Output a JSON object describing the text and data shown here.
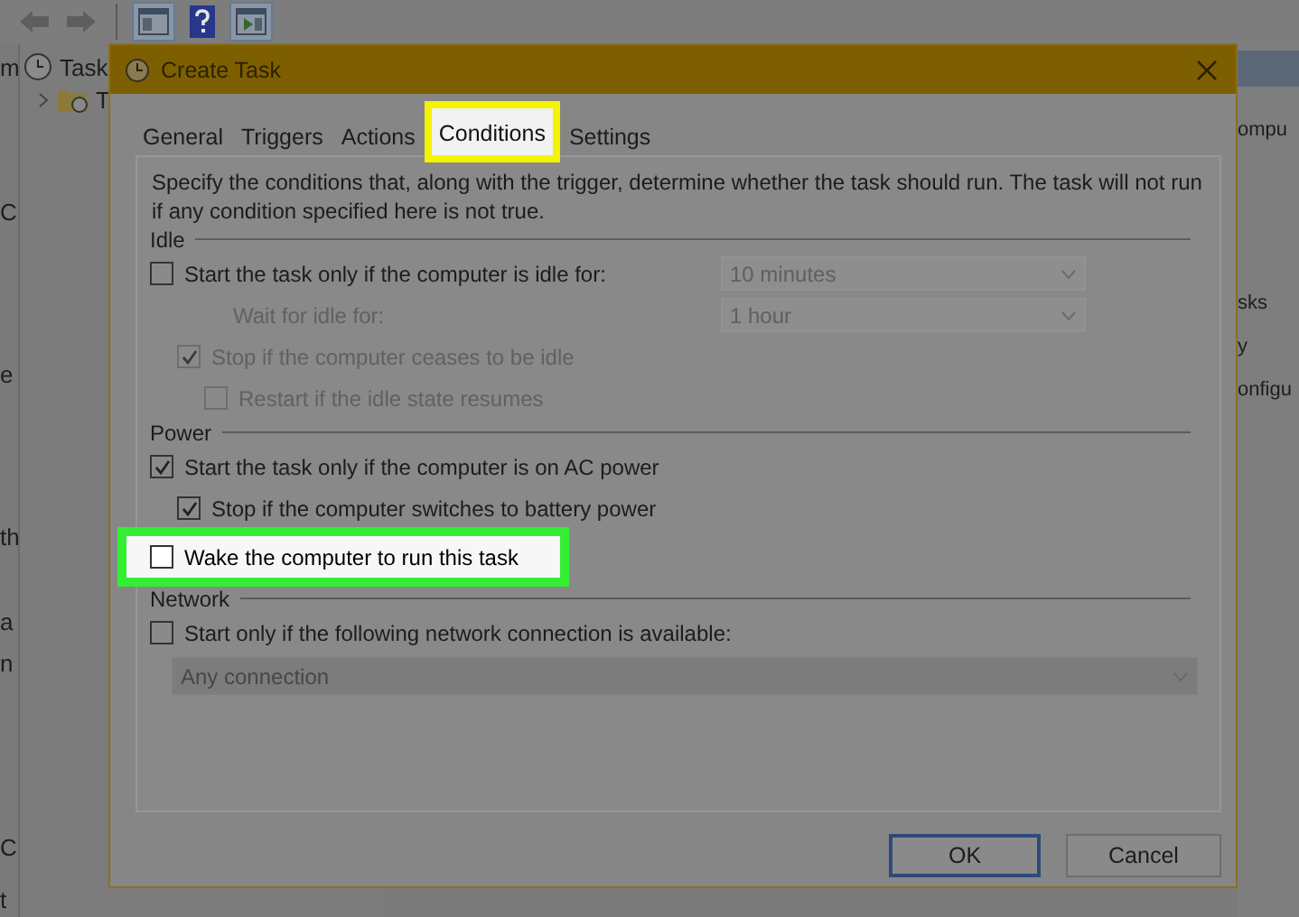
{
  "app": {
    "toolbar": [
      {
        "kind": "back"
      },
      {
        "kind": "forward"
      },
      {
        "kind": "panel"
      },
      {
        "kind": "help"
      },
      {
        "kind": "play-panel"
      }
    ],
    "tree": [
      {
        "label": "Task",
        "children": [
          {
            "label": "T"
          }
        ]
      }
    ],
    "left_fragments": [
      "m",
      "C",
      "e",
      "th",
      "a",
      "n",
      "C",
      "t"
    ],
    "right_fragments": [
      "ompu",
      "sks",
      "y",
      "onfigu"
    ]
  },
  "dialog": {
    "title": "Create Task",
    "tabs": [
      {
        "label": "General",
        "selected": false,
        "highlighted": false
      },
      {
        "label": "Triggers",
        "selected": false,
        "highlighted": false
      },
      {
        "label": "Actions",
        "selected": false,
        "highlighted": false
      },
      {
        "label": "Conditions",
        "selected": true,
        "highlighted": true
      },
      {
        "label": "Settings",
        "selected": false,
        "highlighted": false
      }
    ],
    "description": "Specify the conditions that, along with the trigger, determine whether the task should run.  The task will not run  if any condition specified here is not true.",
    "sections": [
      {
        "heading": "Idle",
        "options": [
          {
            "kind": "checkbox",
            "label": "Start the task only if the computer is idle for:",
            "checked": false,
            "disabled": false,
            "dropdown": {
              "value": "10 minutes",
              "disabled": true
            },
            "children": [
              {
                "kind": "label",
                "label": "Wait for idle for:",
                "disabled": true,
                "dropdown": {
                  "value": "1 hour",
                  "disabled": true
                }
              },
              {
                "kind": "checkbox",
                "label": "Stop if the computer ceases to be idle",
                "checked": true,
                "disabled": true,
                "children": [
                  {
                    "kind": "checkbox",
                    "label": "Restart if the idle state resumes",
                    "checked": false,
                    "disabled": true
                  }
                ]
              }
            ]
          }
        ]
      },
      {
        "heading": "Power",
        "options": [
          {
            "kind": "checkbox",
            "label": "Start the task only if the computer is on AC power",
            "checked": true,
            "disabled": false,
            "children": [
              {
                "kind": "checkbox",
                "label": "Stop if the computer switches to battery power",
                "checked": true,
                "disabled": false
              }
            ]
          },
          {
            "kind": "checkbox",
            "label": "Wake the computer to run this task",
            "checked": false,
            "disabled": false,
            "highlighted": true
          }
        ]
      },
      {
        "heading": "Network",
        "options": [
          {
            "kind": "checkbox",
            "label": "Start only if the following network connection is available:",
            "checked": false,
            "disabled": false
          },
          {
            "kind": "dropdown",
            "value": "Any connection",
            "disabled": true
          }
        ]
      }
    ],
    "buttons": [
      {
        "label": "OK",
        "default": true
      },
      {
        "label": "Cancel",
        "default": false
      }
    ]
  }
}
